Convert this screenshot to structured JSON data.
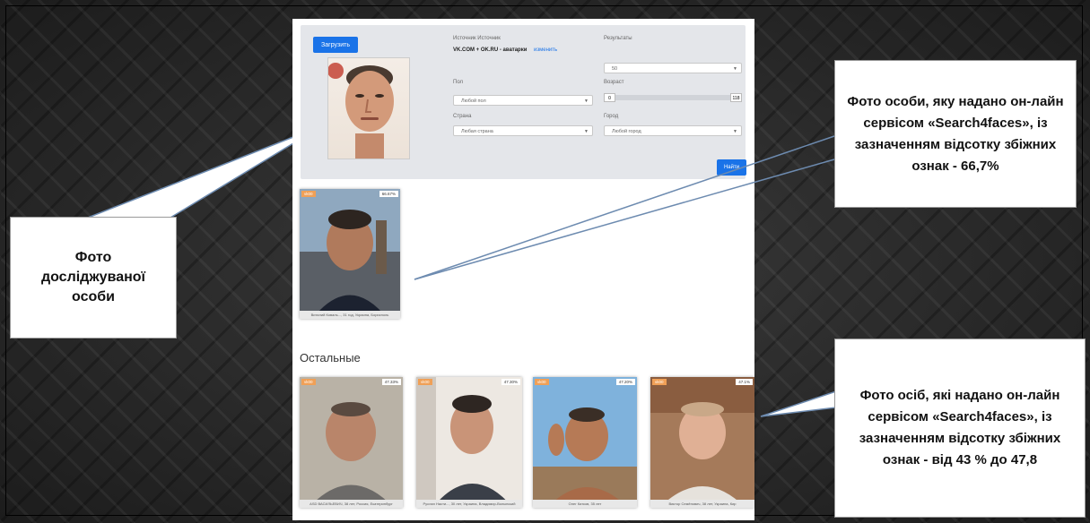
{
  "form": {
    "upload_label": "Загрузить",
    "source_label": "Источник Источник",
    "source_value": "VK.COM + OK.RU - аватарки",
    "source_change": "изменить",
    "results_label": "Результаты",
    "results_value": "50",
    "sex_label": "Пол",
    "sex_value": "Любой пол",
    "age_label": "Возраст",
    "age_from": "0",
    "age_to": "118",
    "country_label": "Страна",
    "country_value": "Любая страна",
    "city_label": "Город",
    "city_value": "Любой город",
    "find_label": "Найти"
  },
  "top_match": {
    "badge": "vk00",
    "percent": "66.67%",
    "caption": "Виталий Коваль..., 31 год, Украина, Борисполь"
  },
  "others_heading": "Остальные",
  "others": [
    {
      "badge": "vk00",
      "percent": "47.33%",
      "caption": "ASD ВАСИЛЬЕВИЧ, 38 лет, Россия, Екатеринбург"
    },
    {
      "badge": "vk00",
      "percent": "47.30%",
      "caption": "Руслан Насти..., 30 лет, Украина, Владимир-Волынский"
    },
    {
      "badge": "vk00",
      "percent": "47.20%",
      "caption": "Олег Катков, 35 лет"
    },
    {
      "badge": "vk00",
      "percent": "47.1%",
      "caption": "Виктор Семёнович, 38 лет, Украина, Кир"
    }
  ],
  "callouts": {
    "left": "Фото досліджуваної особи",
    "top_right": "Фото особи, яку надано он-лайн сервісом «Search4faces», із зазначенням відсотку збіжних ознак  - 66,7%",
    "bottom_right": "Фото осіб, які надано он-лайн сервісом «Search4faces», із зазначенням відсотку збіжних ознак  - від 43 % до 47,8"
  }
}
